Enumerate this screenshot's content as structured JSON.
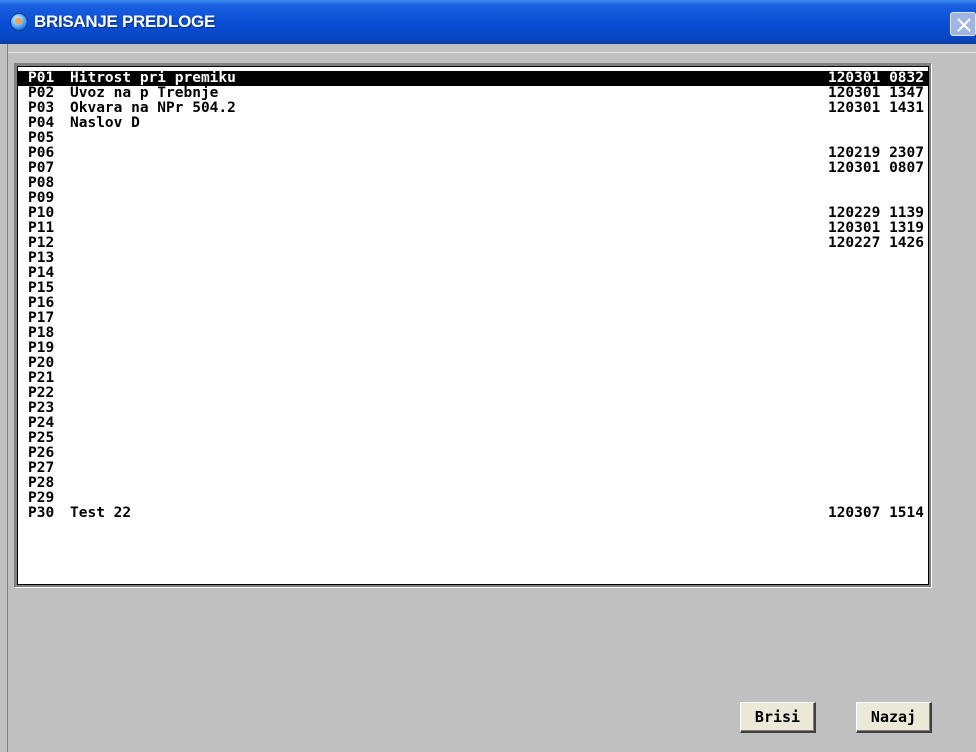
{
  "window": {
    "title": "BRISANJE PREDLOGE"
  },
  "list": {
    "selected_index": 0,
    "rows": [
      {
        "id": "P01",
        "name": "Hitrost pri premiku",
        "stamp": "120301 0832"
      },
      {
        "id": "P02",
        "name": "Uvoz na p Trebnje",
        "stamp": "120301 1347"
      },
      {
        "id": "P03",
        "name": "Okvara na NPr 504.2",
        "stamp": "120301 1431"
      },
      {
        "id": "P04",
        "name": "Naslov D",
        "stamp": ""
      },
      {
        "id": "P05",
        "name": "",
        "stamp": ""
      },
      {
        "id": "P06",
        "name": "",
        "stamp": "120219 2307"
      },
      {
        "id": "P07",
        "name": "",
        "stamp": "120301 0807"
      },
      {
        "id": "P08",
        "name": "",
        "stamp": ""
      },
      {
        "id": "P09",
        "name": "",
        "stamp": ""
      },
      {
        "id": "P10",
        "name": "",
        "stamp": "120229 1139"
      },
      {
        "id": "P11",
        "name": "",
        "stamp": "120301 1319"
      },
      {
        "id": "P12",
        "name": "",
        "stamp": "120227 1426"
      },
      {
        "id": "P13",
        "name": "",
        "stamp": ""
      },
      {
        "id": "P14",
        "name": "",
        "stamp": ""
      },
      {
        "id": "P15",
        "name": "",
        "stamp": ""
      },
      {
        "id": "P16",
        "name": "",
        "stamp": ""
      },
      {
        "id": "P17",
        "name": "",
        "stamp": ""
      },
      {
        "id": "P18",
        "name": "",
        "stamp": ""
      },
      {
        "id": "P19",
        "name": "",
        "stamp": ""
      },
      {
        "id": "P20",
        "name": "",
        "stamp": ""
      },
      {
        "id": "P21",
        "name": "",
        "stamp": ""
      },
      {
        "id": "P22",
        "name": "",
        "stamp": ""
      },
      {
        "id": "P23",
        "name": "",
        "stamp": ""
      },
      {
        "id": "P24",
        "name": "",
        "stamp": ""
      },
      {
        "id": "P25",
        "name": "",
        "stamp": ""
      },
      {
        "id": "P26",
        "name": "",
        "stamp": ""
      },
      {
        "id": "P27",
        "name": "",
        "stamp": ""
      },
      {
        "id": "P28",
        "name": "",
        "stamp": ""
      },
      {
        "id": "P29",
        "name": "",
        "stamp": ""
      },
      {
        "id": "P30",
        "name": "Test 22",
        "stamp": "120307 1514"
      }
    ]
  },
  "buttons": {
    "delete_label": "Brisi",
    "back_label": "Nazaj"
  },
  "colors": {
    "title_bar": "#0a4fd6",
    "selection_bg": "#000000",
    "selection_fg": "#ffffff",
    "window_bg": "#c0c0c0"
  },
  "icons": {
    "app": "globe-icon",
    "close": "close-icon"
  }
}
